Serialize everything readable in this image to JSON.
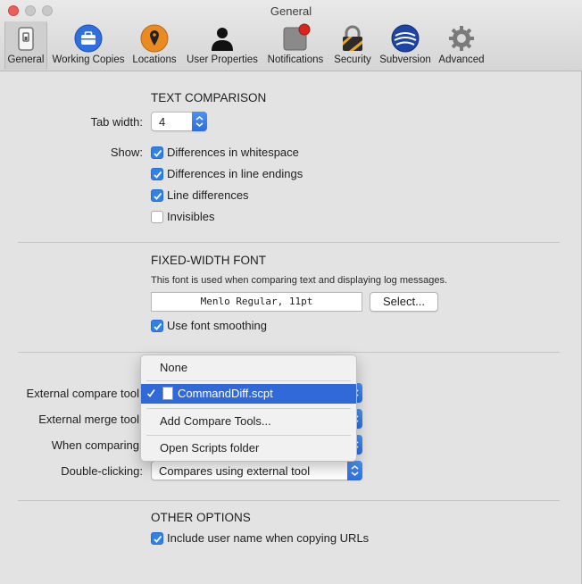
{
  "window": {
    "title": "General"
  },
  "toolbar": {
    "items": [
      {
        "label": "General",
        "icon": "general-switch-icon",
        "selected": true
      },
      {
        "label": "Working Copies",
        "icon": "briefcase-icon"
      },
      {
        "label": "Locations",
        "icon": "location-pin-icon"
      },
      {
        "label": "User Properties",
        "icon": "user-icon"
      },
      {
        "label": "Notifications",
        "icon": "notification-badge-icon"
      },
      {
        "label": "Security",
        "icon": "padlock-icon"
      },
      {
        "label": "Subversion",
        "icon": "subversion-logo-icon"
      },
      {
        "label": "Advanced",
        "icon": "gear-icon"
      }
    ]
  },
  "text_comparison": {
    "title": "TEXT COMPARISON",
    "tab_width_label": "Tab width:",
    "tab_width_value": "4",
    "show_label": "Show:",
    "options": [
      {
        "label": "Differences in whitespace",
        "checked": true
      },
      {
        "label": "Differences in line endings",
        "checked": true
      },
      {
        "label": "Line differences",
        "checked": true
      },
      {
        "label": "Invisibles",
        "checked": false
      }
    ]
  },
  "fixed_width_font": {
    "title": "FIXED-WIDTH FONT",
    "hint": "This font is used when comparing text and displaying log messages.",
    "font_value": "Menlo Regular, 11pt",
    "select_button": "Select...",
    "smoothing_label": "Use font smoothing",
    "smoothing_checked": true
  },
  "tools": {
    "external_compare_label": "External compare tool",
    "external_merge_label": "External merge tool",
    "when_comparing_label": "When comparing",
    "double_clicking_label": "Double-clicking:",
    "double_clicking_value": "Compares using external tool"
  },
  "dropdown_menu": {
    "none": "None",
    "selected": "CommandDiff.scpt",
    "add": "Add Compare Tools...",
    "open": "Open Scripts folder"
  },
  "other_options": {
    "title": "OTHER OPTIONS",
    "include_user_label": "Include user name when copying URLs",
    "include_user_checked": true
  },
  "colors": {
    "accent": "#3169d8",
    "checkbox": "#2f80ea",
    "close": "#ec5f57"
  }
}
